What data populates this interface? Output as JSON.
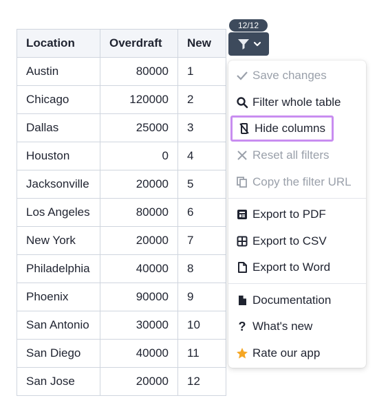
{
  "table": {
    "headers": [
      "Location",
      "Overdraft",
      "New"
    ],
    "rows": [
      [
        "Austin",
        "80000",
        "1"
      ],
      [
        "Chicago",
        "120000",
        "2"
      ],
      [
        "Dallas",
        "25000",
        "3"
      ],
      [
        "Houston",
        "0",
        "4"
      ],
      [
        "Jacksonville",
        "20000",
        "5"
      ],
      [
        "Los Angeles",
        "80000",
        "6"
      ],
      [
        "New York",
        "20000",
        "7"
      ],
      [
        "Philadelphia",
        "40000",
        "8"
      ],
      [
        "Phoenix",
        "90000",
        "9"
      ],
      [
        "San Antonio",
        "30000",
        "10"
      ],
      [
        "San Diego",
        "40000",
        "11"
      ],
      [
        "San Jose",
        "20000",
        "12"
      ]
    ]
  },
  "filter": {
    "count_badge": "12/12",
    "icon": "filter-icon"
  },
  "menu": {
    "save_changes": "Save changes",
    "filter_whole_table": "Filter whole table",
    "hide_columns": "Hide columns",
    "reset_all_filters": "Reset all filters",
    "copy_filter_url": "Copy the filter URL",
    "export_pdf": "Export to PDF",
    "export_csv": "Export to CSV",
    "export_word": "Export to Word",
    "documentation": "Documentation",
    "whats_new": "What's new",
    "rate_app": "Rate our app"
  },
  "colors": {
    "button_bg": "#3d4a5c",
    "highlight_border": "#c88df0",
    "star": "#f5a623",
    "disabled_text": "#9aa0aa"
  }
}
